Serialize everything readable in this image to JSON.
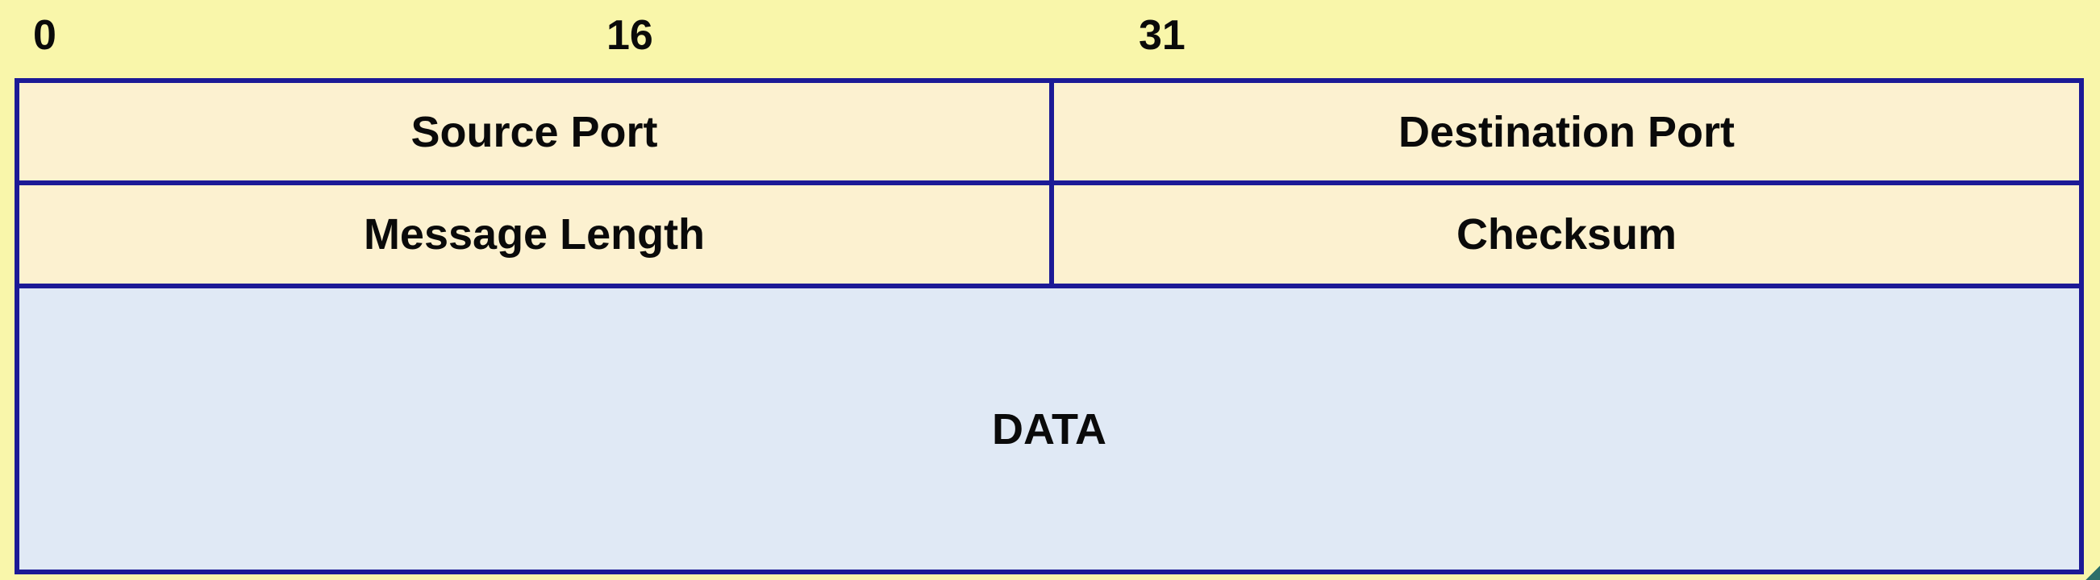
{
  "bit_labels": {
    "start": "0",
    "mid": "16",
    "end": "31"
  },
  "header": {
    "row1": {
      "left": "Source Port",
      "right": "Destination Port"
    },
    "row2": {
      "left": "Message Length",
      "right": "Checksum"
    }
  },
  "payload": {
    "label": "DATA"
  },
  "colors": {
    "background": "#f9f6aa",
    "border": "#1c1a96",
    "header_fill": "#fcf1d0",
    "data_fill": "#e0e9f5"
  }
}
